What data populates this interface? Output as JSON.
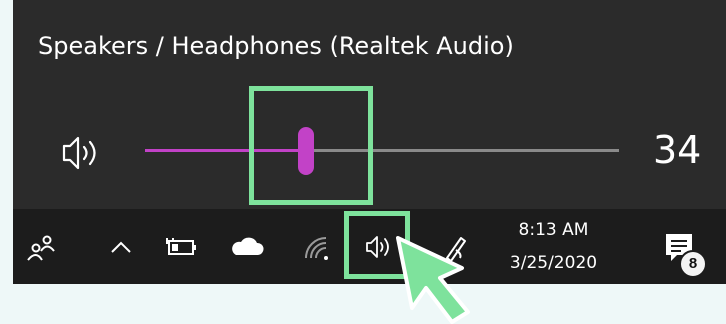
{
  "colors": {
    "page_bg": "#eef8f8",
    "flyout_bg": "#2b2b2b",
    "taskbar_bg": "#1c1c1c",
    "accent": "#c242c7",
    "highlight": "#7ee29c"
  },
  "volume_flyout": {
    "device_name": "Speakers / Headphones (Realtek Audio)",
    "speaker_icon": "speaker-volume-icon",
    "volume": 34,
    "volume_label": "34"
  },
  "taskbar": {
    "icons": [
      "people-icon",
      "chevron-up-icon",
      "battery-plugged-icon",
      "onedrive-cloud-icon",
      "wifi-icon",
      "speaker-icon",
      "pen-ink-icon",
      "notifications-icon"
    ],
    "time": "8:13 AM",
    "date": "3/25/2020",
    "notification_count": "8"
  }
}
